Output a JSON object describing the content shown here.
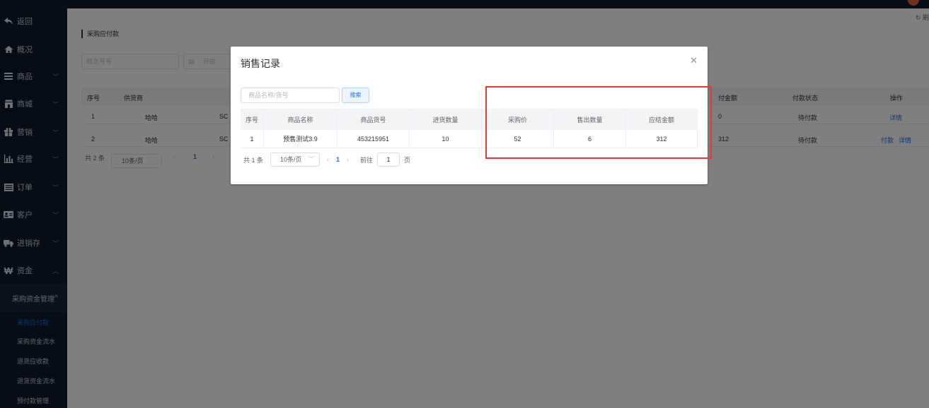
{
  "sidebar": {
    "items": [
      {
        "label": "返回",
        "icon": "back-arrow-icon"
      },
      {
        "label": "概况",
        "icon": "home-icon"
      },
      {
        "label": "商品",
        "icon": "list-icon"
      },
      {
        "label": "商城",
        "icon": "shop-icon"
      },
      {
        "label": "营销",
        "icon": "gift-icon"
      },
      {
        "label": "经营",
        "icon": "bar-chart-icon"
      },
      {
        "label": "订单",
        "icon": "order-list-icon"
      },
      {
        "label": "客户",
        "icon": "id-card-icon"
      },
      {
        "label": "进销存",
        "icon": "truck-icon"
      },
      {
        "label": "资金",
        "icon": "yuan-icon"
      }
    ],
    "group_label": "采购资金管理",
    "sub_items": [
      {
        "label": "采购应付款",
        "active": true
      },
      {
        "label": "采购资金流水",
        "active": false
      },
      {
        "label": "退货应收款",
        "active": false
      },
      {
        "label": "退货资金流水",
        "active": false
      },
      {
        "label": "预付款管理",
        "active": false
      }
    ]
  },
  "main": {
    "title": "采购应付款",
    "batch_placeholder": "批次号号",
    "date_start_placeholder": "开始",
    "table_headers": [
      "序号",
      "供货商",
      "付金额",
      "付款状态",
      "操作"
    ],
    "rows": [
      {
        "index": "1",
        "supplier": "哈哈",
        "code_prefix": "SC",
        "amount": "0",
        "status": "待付款",
        "actions": [
          "详情"
        ]
      },
      {
        "index": "2",
        "supplier": "哈哈",
        "code_prefix": "SC",
        "amount": "312",
        "status": "待付款",
        "actions": [
          "付款",
          "详情"
        ]
      }
    ],
    "pager": {
      "total": "共 2 条",
      "page_size": "10条/页",
      "current": "1"
    },
    "refresh_icon": "refresh-icon"
  },
  "modal": {
    "title": "销售记录",
    "search_placeholder": "商品名称/货号",
    "search_button": "搜索",
    "headers": [
      "序号",
      "商品名称",
      "商品货号",
      "进货数量",
      "采购价",
      "售出数量",
      "应结金额"
    ],
    "rows": [
      [
        "1",
        "预售测试3.9",
        "453215951",
        "10",
        "52",
        "6",
        "312"
      ]
    ],
    "pager": {
      "total": "共 1 条",
      "page_size": "10条/页",
      "current": "1",
      "goto_label": "前往",
      "goto_value": "1",
      "page_unit": "页"
    }
  },
  "colors": {
    "sidebar_bg": "#0f1b2c",
    "accent": "#1d6ff0",
    "highlight_box": "#e53935"
  }
}
